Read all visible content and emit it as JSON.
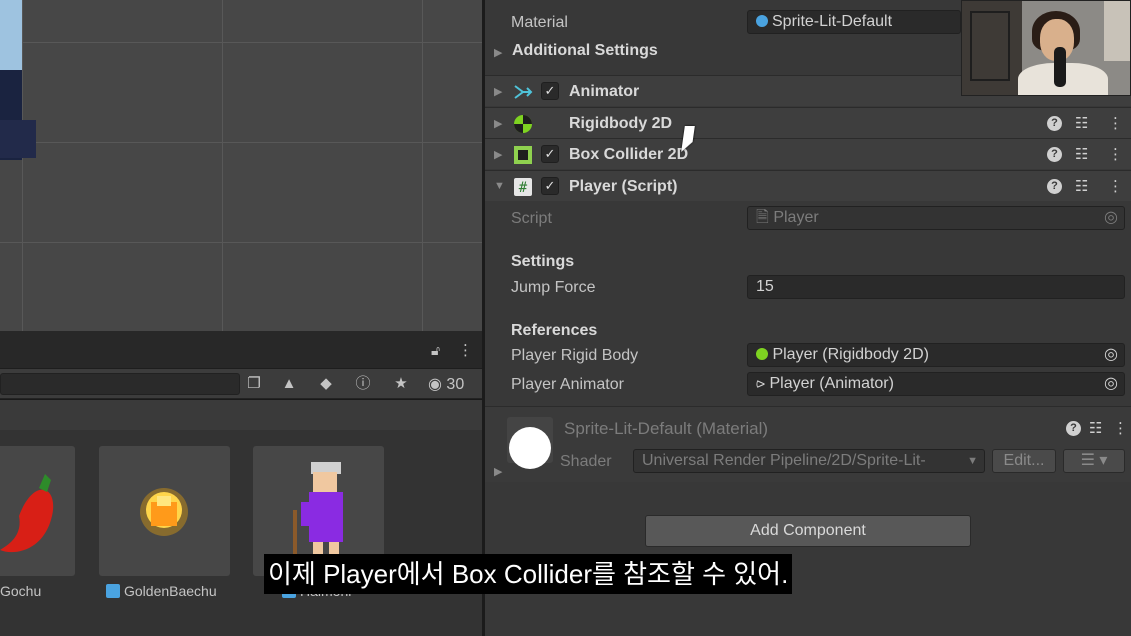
{
  "inspector": {
    "material_label": "Material",
    "material_value": "Sprite-Lit-Default",
    "additional_settings": "Additional Settings",
    "components": {
      "animator": "Animator",
      "rigidbody": "Rigidbody 2D",
      "box_collider": "Box Collider 2D",
      "player_script": "Player (Script)"
    },
    "script_label": "Script",
    "script_value": "Player",
    "settings_header": "Settings",
    "jump_force_label": "Jump Force",
    "jump_force_value": "15",
    "references_header": "References",
    "rigid_body_label": "Player Rigid Body",
    "rigid_body_value": "Player (Rigidbody 2D)",
    "animator_label": "Player Animator",
    "animator_value": "Player (Animator)",
    "material_section_title": "Sprite-Lit-Default (Material)",
    "shader_label": "Shader",
    "shader_value": "Universal Render Pipeline/2D/Sprite-Lit-",
    "edit_button": "Edit...",
    "add_component_button": "Add Component"
  },
  "project": {
    "hidden_count": "30",
    "items": [
      "Gochu",
      "GoldenBaechu",
      "Halmoni"
    ]
  },
  "subtitle": "이제 Player에서 Box Collider를 참조할 수 있어.",
  "colors": {
    "rigidbody_icon": "#7ed321",
    "collider_icon": "#8fd14f",
    "accent_blue": "#4aa3e0"
  }
}
